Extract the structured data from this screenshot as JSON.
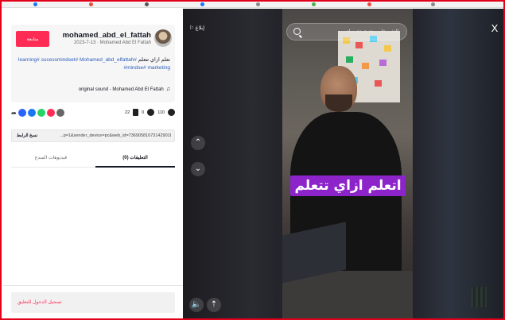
{
  "author": {
    "username": "mohamed_abd_el_fattah",
    "date_line": "2023-7-13 · Mohamed Abd El Fattah",
    "follow_label": "متابعة"
  },
  "post": {
    "text_prefix": "تعلم ازاي تتعلم",
    "hashtags": "learning# sucessmindset# Mohamed_abd_elfattah# mindse# marketing#",
    "sound": "original sound - Mohamed Abd El Fattah"
  },
  "stats": {
    "likes": "110",
    "comments": "0",
    "saves": "22"
  },
  "share": {
    "url": "...p=1&sender_device=pc&web_id=7369058107314290182",
    "copy_label": "نسخ الرابط"
  },
  "tabs": [
    {
      "label": "التعليقات (0)"
    },
    {
      "label": "فيديوهات المبدع"
    }
  ],
  "comment": {
    "login_prompt": "تسجيل الدخول للتعليق"
  },
  "player": {
    "search_placeholder": "العثور على محتوى ذي صلة",
    "report_label": "إبلاغ",
    "close_label": "X",
    "caption": "اتعلم ازاي تتعلم"
  },
  "colors": {
    "accent": "#fe2c55",
    "hashtag": "#2b5db9",
    "caption_bg": "#8c24c9"
  }
}
